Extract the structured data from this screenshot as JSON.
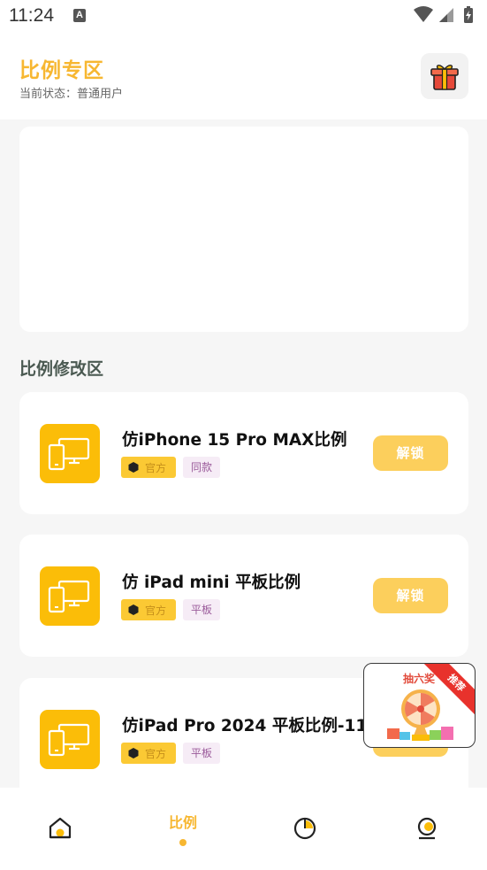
{
  "status_bar": {
    "time": "11:24",
    "indicator": "A"
  },
  "header": {
    "title": "比例专区",
    "subtitle": "当前状态：普通用户",
    "gift_icon": "gift-icon"
  },
  "section": {
    "title": "比例修改区"
  },
  "cards": [
    {
      "title": "仿iPhone 15 Pro MAX比例",
      "official_tag": "官方",
      "tag": "同款",
      "button": "解锁"
    },
    {
      "title": "仿 iPad mini 平板比例",
      "official_tag": "官方",
      "tag": "平板",
      "button": "解锁"
    },
    {
      "title": "仿iPad Pro 2024 平板比例-11寸",
      "official_tag": "官方",
      "tag": "平板",
      "button": "解锁"
    }
  ],
  "float_ad": {
    "title": "抽六奖",
    "ribbon": "推荐"
  },
  "bottom_nav": {
    "items": [
      {
        "icon": "home-icon",
        "label": ""
      },
      {
        "icon": "ratio-icon",
        "label": "比例",
        "active": true
      },
      {
        "icon": "pie-chart-icon",
        "label": ""
      },
      {
        "icon": "profile-icon",
        "label": ""
      }
    ]
  },
  "colors": {
    "accent": "#f7b731",
    "icon_bg": "#fbbd08",
    "button": "#fccf5c",
    "section_title": "#4b5a52"
  }
}
